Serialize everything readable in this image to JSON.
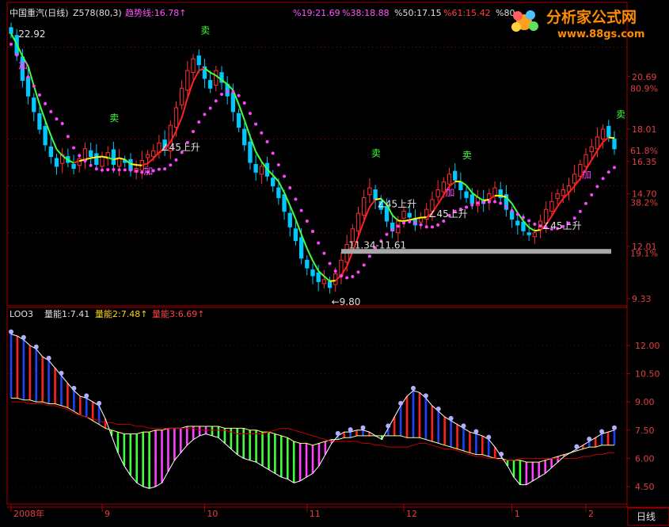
{
  "header": {
    "title": "中国重汽(日线)",
    "indicator": "Z578(80,3)",
    "trend": "趋势线:16.78↑",
    "p1": "%19:21.69",
    "p2": "%38:18.88",
    "p3": "%50:17.15",
    "p4": "%61:15.42",
    "p5": "%80:"
  },
  "watermark": {
    "name": "分析家公式网",
    "url": "www.88gs.com"
  },
  "volume_header": {
    "name": "LOO3",
    "v1": "量能1:7.41",
    "v2": "量能2:7.48↑",
    "v3": "量能3:6.69↑"
  },
  "period": "日线",
  "colors": {
    "up": "#ff3030",
    "down": "#00c8ff",
    "trend": "#ff44ff",
    "ma_up": "#ff2020",
    "ma_down": "#40ff40",
    "ma_flat": "#ffff00"
  },
  "chart_data": [
    {
      "type": "candlestick",
      "title": "中国重汽(日线)",
      "y_ticks": [
        20.69,
        18.01,
        16.35,
        14.7,
        12.01,
        9.33
      ],
      "y_pct_ticks": [
        {
          "price": 20.1,
          "label": "80.9%"
        },
        {
          "price": 16.9,
          "label": "61.8%"
        },
        {
          "price": 14.26,
          "label": "38.2%"
        },
        {
          "price": 11.65,
          "label": "19.1%"
        }
      ],
      "ylim": [
        9.0,
        23.6
      ],
      "dotted_levels": [
        22.2,
        17.5,
        15.1,
        12.7
      ],
      "x_date_labels": [
        "2008年",
        "9",
        "10",
        "11",
        "12",
        "1",
        "2"
      ],
      "closes": [
        22.9,
        21.8,
        20.5,
        19.7,
        18.9,
        18.0,
        17.2,
        16.6,
        16.1,
        16.7,
        16.3,
        16.0,
        16.5,
        17.0,
        16.6,
        16.2,
        16.6,
        16.8,
        16.2,
        16.5,
        16.3,
        15.9,
        16.0,
        16.4,
        16.7,
        16.9,
        17.3,
        17.0,
        18.2,
        19.1,
        20.1,
        21.0,
        21.6,
        21.3,
        20.6,
        20.1,
        21.0,
        20.4,
        19.7,
        18.9,
        18.1,
        17.2,
        16.3,
        15.8,
        16.1,
        15.6,
        15.1,
        14.5,
        13.8,
        13.0,
        12.3,
        11.4,
        10.9,
        10.5,
        10.2,
        10.3,
        9.9,
        10.6,
        11.3,
        12.1,
        12.9,
        13.7,
        14.5,
        15.0,
        14.4,
        13.9,
        13.3,
        12.8,
        13.3,
        13.8,
        13.5,
        13.1,
        13.5,
        13.9,
        14.4,
        14.9,
        15.3,
        15.7,
        15.4,
        14.9,
        14.5,
        14.2,
        14.5,
        14.2,
        14.7,
        15.0,
        14.5,
        13.9,
        13.4,
        13.1,
        12.8,
        12.6,
        12.7,
        13.3,
        13.9,
        14.3,
        14.7,
        14.9,
        15.1,
        15.7,
        16.2,
        16.7,
        17.1,
        17.6,
        18.0,
        17.6,
        17.0
      ],
      "annotations": [
        {
          "i": 1,
          "text": "22.92",
          "color": "#e0e0e0"
        },
        {
          "i": 56,
          "text": "←9.80",
          "color": "#e0e0e0"
        },
        {
          "i": 59,
          "text": "11.34-11.61",
          "color": "#e0e0e0"
        },
        {
          "i": 26,
          "text": "∠45上升",
          "color": "#e0e0e0"
        },
        {
          "i": 64,
          "text": "∠45上升",
          "color": "#e0e0e0"
        },
        {
          "i": 73,
          "text": "∠45上升",
          "color": "#e0e0e0"
        },
        {
          "i": 93,
          "text": "∠45上升",
          "color": "#e0e0e0"
        },
        {
          "i": 1,
          "text": "加",
          "color": "#ff44ff"
        },
        {
          "i": 23,
          "text": "加",
          "color": "#ff44ff"
        },
        {
          "i": 76,
          "text": "加",
          "color": "#ff44ff"
        },
        {
          "i": 100,
          "text": "加",
          "color": "#ff44ff"
        },
        {
          "i": 17,
          "text": "卖",
          "color": "#40ff40"
        },
        {
          "i": 33,
          "text": "卖",
          "color": "#40ff40"
        },
        {
          "i": 63,
          "text": "卖",
          "color": "#40ff40"
        },
        {
          "i": 79,
          "text": "卖",
          "color": "#40ff40"
        },
        {
          "i": 106,
          "text": "卖",
          "color": "#40ff40"
        }
      ]
    },
    {
      "type": "bar",
      "title": "LOO3",
      "y_ticks": [
        12.0,
        10.5,
        9.0,
        7.5,
        6.0,
        4.5
      ],
      "ylim": [
        3.7,
        13.3
      ],
      "values": [
        12.6,
        12.5,
        12.3,
        12.0,
        11.8,
        11.4,
        11.2,
        10.8,
        10.4,
        10.0,
        9.6,
        9.3,
        9.2,
        9.0,
        8.8,
        8.1,
        7.2,
        6.3,
        5.6,
        5.1,
        4.7,
        4.5,
        4.4,
        4.5,
        4.7,
        5.3,
        5.9,
        6.3,
        6.7,
        7.0,
        7.2,
        7.3,
        7.2,
        7.1,
        6.8,
        6.5,
        6.2,
        6.0,
        5.9,
        5.8,
        5.6,
        5.4,
        5.2,
        5.0,
        4.9,
        4.7,
        4.8,
        5.0,
        5.2,
        5.6,
        6.2,
        6.8,
        7.2,
        7.4,
        7.4,
        7.5,
        7.5,
        7.4,
        7.2,
        7.0,
        7.6,
        8.2,
        8.8,
        9.3,
        9.6,
        9.5,
        9.2,
        8.8,
        8.5,
        8.2,
        8.0,
        7.8,
        7.6,
        7.4,
        7.3,
        7.2,
        7.0,
        6.6,
        6.1,
        5.6,
        5.0,
        4.6,
        4.6,
        4.8,
        5.0,
        5.2,
        5.5,
        5.8,
        6.1,
        6.3,
        6.5,
        6.7,
        6.9,
        7.1,
        7.3,
        7.4,
        7.5
      ],
      "baseline": [
        9.2,
        9.2,
        9.1,
        9.1,
        9.0,
        9.0,
        8.9,
        8.9,
        8.8,
        8.7,
        8.5,
        8.3,
        8.2,
        8.0,
        7.8,
        7.6,
        7.5,
        7.4,
        7.3,
        7.3,
        7.3,
        7.4,
        7.4,
        7.5,
        7.5,
        7.6,
        7.6,
        7.6,
        7.7,
        7.7,
        7.7,
        7.7,
        7.7,
        7.7,
        7.6,
        7.6,
        7.6,
        7.6,
        7.5,
        7.5,
        7.4,
        7.4,
        7.3,
        7.2,
        7.1,
        6.9,
        6.8,
        6.8,
        6.7,
        6.8,
        6.9,
        7.0,
        7.0,
        7.1,
        7.1,
        7.2,
        7.2,
        7.2,
        7.2,
        7.2,
        7.2,
        7.2,
        7.2,
        7.1,
        7.1,
        7.1,
        7.0,
        6.9,
        6.8,
        6.7,
        6.6,
        6.5,
        6.4,
        6.3,
        6.2,
        6.2,
        6.1,
        6.0,
        6.0,
        5.9,
        5.9,
        5.9,
        5.8,
        5.8,
        5.8,
        5.9,
        6.0,
        6.1,
        6.2,
        6.3,
        6.4,
        6.5,
        6.6,
        6.6,
        6.7,
        6.7,
        6.7
      ],
      "redline": [
        9.0,
        9.0,
        9.0,
        8.9,
        8.9,
        8.9,
        8.8,
        8.8,
        8.7,
        8.6,
        8.4,
        8.3,
        8.2,
        8.1,
        8.0,
        7.9,
        7.9,
        7.8,
        7.8,
        7.8,
        7.7,
        7.7,
        7.6,
        7.6,
        7.6,
        7.6,
        7.6,
        7.6,
        7.6,
        7.6,
        7.5,
        7.5,
        7.5,
        7.5,
        7.5,
        7.4,
        7.3,
        7.3,
        7.3,
        7.3,
        7.3,
        7.4,
        7.5,
        7.6,
        7.6,
        7.5,
        7.4,
        7.3,
        7.2,
        7.1,
        7.0,
        6.9,
        6.9,
        6.9,
        6.9,
        6.9,
        6.8,
        6.8,
        6.7,
        6.7,
        6.6,
        6.6,
        6.6,
        6.6,
        6.7,
        6.8,
        6.8,
        6.7,
        6.6,
        6.5,
        6.5,
        6.4,
        6.3,
        6.2,
        6.1,
        6.1,
        6.0,
        6.0,
        5.9,
        5.9,
        5.9,
        6.0,
        6.0,
        6.0,
        6.0,
        6.0,
        6.0,
        6.0,
        6.0,
        6.0,
        6.0,
        6.1,
        6.1,
        6.2,
        6.2,
        6.3,
        6.3
      ]
    }
  ]
}
